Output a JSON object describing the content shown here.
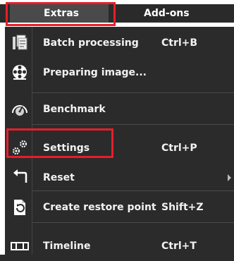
{
  "menubar": {
    "extras_label": "Extras",
    "addons_label": "Add-ons"
  },
  "menu": {
    "items": [
      {
        "label": "Batch processing",
        "shortcut": "Ctrl+B",
        "icon": "batch-icon"
      },
      {
        "label": "Preparing image...",
        "shortcut": "",
        "icon": "film-reel-icon"
      },
      {
        "label": "Benchmark",
        "shortcut": "",
        "icon": "speedometer-icon"
      },
      {
        "label": "Settings",
        "shortcut": "Ctrl+P",
        "icon": "gears-icon"
      },
      {
        "label": "Reset",
        "shortcut": "",
        "icon": "undo-arrow-icon"
      },
      {
        "label": "Create restore point",
        "shortcut": "Shift+Z",
        "icon": "restore-document-icon"
      },
      {
        "label": "Timeline",
        "shortcut": "Ctrl+T",
        "icon": "timeline-icon"
      }
    ]
  },
  "colors": {
    "highlight": "#e61e2a",
    "menu_background": "#2b2b2b",
    "text": "#f2f2f2"
  }
}
